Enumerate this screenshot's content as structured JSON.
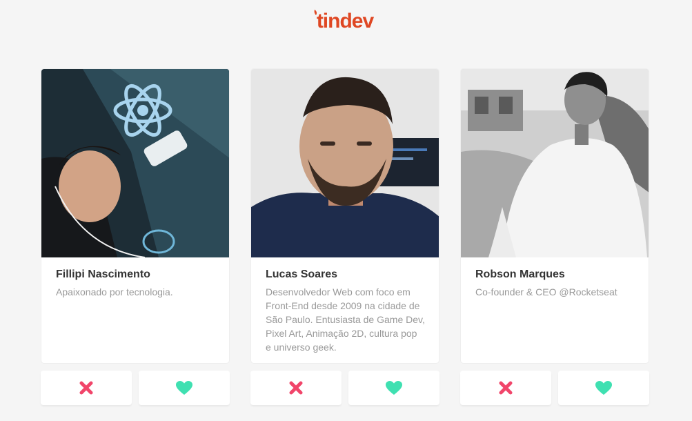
{
  "app": {
    "logo_text": "tindev",
    "logo_color": "#df4723"
  },
  "colors": {
    "dislike": "#f1456a",
    "like": "#3fe0b1"
  },
  "icons": {
    "dislike": "close-icon",
    "like": "heart-icon"
  },
  "users": [
    {
      "name": "Fillipi Nascimento",
      "bio": "Apaixonado por tecnologia."
    },
    {
      "name": "Lucas Soares",
      "bio": "Desenvolvedor Web com foco em Front-End desde 2009 na cidade de São Paulo. Entusiasta de Game Dev, Pixel Art, Animação 2D, cultura pop e universo geek."
    },
    {
      "name": "Robson Marques",
      "bio": "Co-founder & CEO @Rocketseat"
    }
  ]
}
